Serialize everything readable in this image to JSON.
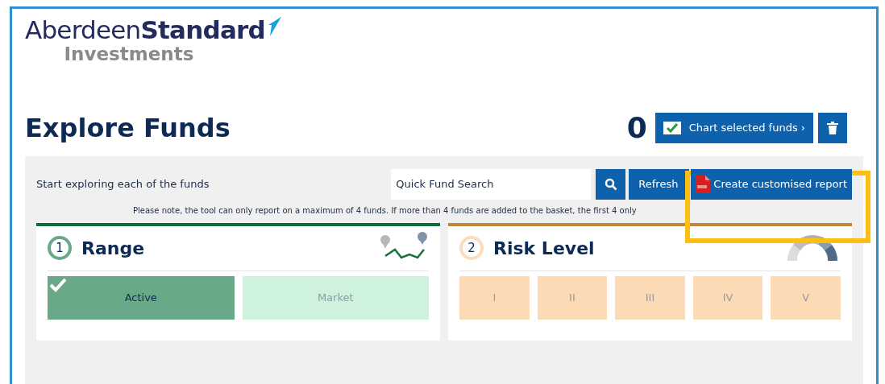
{
  "logo": {
    "name_light": "Aberdeen",
    "name_bold": "Standard",
    "tagline": "Investments"
  },
  "title": "Explore Funds",
  "basket": {
    "count": "0",
    "chart_button": "Chart selected funds ›"
  },
  "toolbar": {
    "intro": "Start exploring each of the funds",
    "search": {
      "placeholder": "Quick Fund Search"
    },
    "refresh_button": "Refresh",
    "report_button": "Create customised report",
    "highlighted": true
  },
  "notice": "Please note, the tool can only report on a maximum of 4 funds. If more than 4 funds are added to the basket, the first 4 only",
  "steps": [
    {
      "number": "1",
      "title": "Range",
      "kind": "range",
      "options": [
        {
          "label": "Active",
          "selected": true
        },
        {
          "label": "Market",
          "selected": false
        }
      ]
    },
    {
      "number": "2",
      "title": "Risk Level",
      "kind": "risk",
      "options": [
        {
          "label": "I",
          "selected": false
        },
        {
          "label": "II",
          "selected": false
        },
        {
          "label": "III",
          "selected": false
        },
        {
          "label": "IV",
          "selected": false
        },
        {
          "label": "V",
          "selected": false
        }
      ]
    }
  ]
}
